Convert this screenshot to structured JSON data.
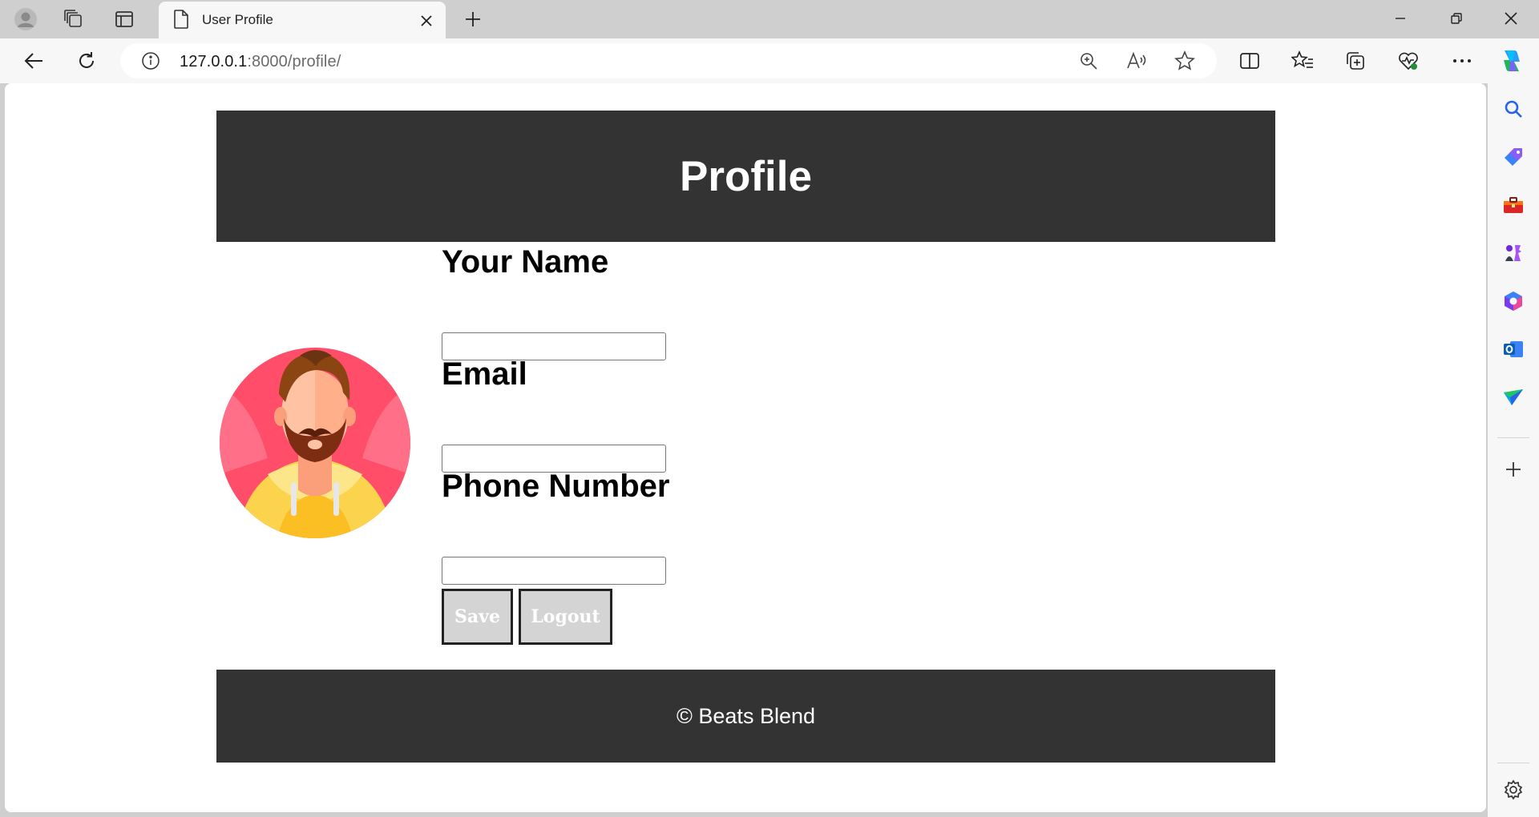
{
  "browser": {
    "tab": {
      "title": "User Profile",
      "close_icon": "close-icon"
    },
    "address": {
      "host": "127.0.0.1",
      "port_path": ":8000/profile/"
    }
  },
  "page": {
    "header_title": "Profile",
    "form": {
      "name_label": "Your Name",
      "name_value": "",
      "email_label": "Email",
      "email_value": "",
      "phone_label": "Phone Number",
      "phone_value": ""
    },
    "buttons": {
      "save": "Save",
      "logout": "Logout"
    },
    "footer_text": "© Beats Blend"
  },
  "colors": {
    "header_bg": "#333333",
    "button_bg": "#d4d4d4",
    "avatar_bg": "#ff4d6a",
    "hoodie": "#fcd34d"
  }
}
